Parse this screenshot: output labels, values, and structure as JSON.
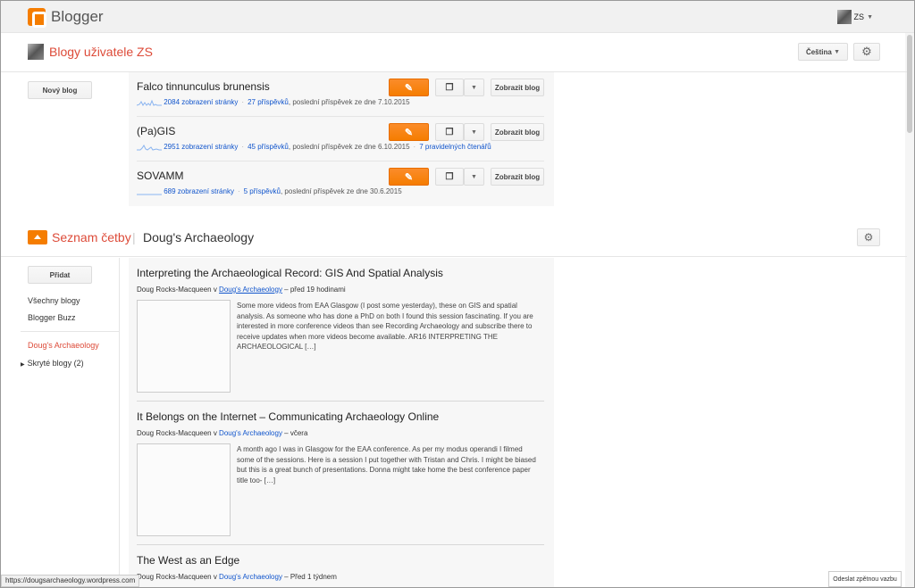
{
  "app": {
    "brand": "Blogger"
  },
  "user": {
    "initials": "ZS"
  },
  "blogs_section": {
    "title": "Blogy uživatele ZS",
    "language": "Čeština",
    "new_blog_label": "Nový blog",
    "view_label": "Zobrazit blog",
    "blogs": [
      {
        "name": "Falco tinnunculus brunensis",
        "views": "2084 zobrazení stránky",
        "posts": "27 příspěvků",
        "last": ", poslední příspěvek ze dne 7.10.2015",
        "readers": ""
      },
      {
        "name": "(Pa)GIS",
        "views": "2951 zobrazení stránky",
        "posts": "45 příspěvků",
        "last": ", poslední příspěvek ze dne 6.10.2015",
        "readers": "7 pravidelných čtenářů"
      },
      {
        "name": "SOVAMM",
        "views": "689 zobrazení stránky",
        "posts": "5 příspěvků",
        "last": ", poslední příspěvek ze dne 30.6.2015",
        "readers": ""
      }
    ]
  },
  "reading_section": {
    "title": "Seznam četby",
    "current": "Doug's Archaeology",
    "add_label": "Přidat",
    "sidebar": {
      "all": "Všechny blogy",
      "buzz": "Blogger Buzz",
      "active": "Doug's Archaeology",
      "hidden": "Skryté blogy (2)"
    },
    "posts": [
      {
        "title": "Interpreting the Archaeological Record: GIS And Spatial Analysis",
        "author": "Doug Rocks-Macqueen v ",
        "source": "Doug's Archaeology",
        "time": " – před 19 hodinami",
        "excerpt": "Some more videos from EAA Glasgow (I post some yesterday), these on GIS and spatial analysis. As someone who has done a PhD on both I found this session fascinating. If you are interested in more conference videos than see Recording Archaeology and subscribe there to receive updates when more videos become available. AR16 INTERPRETING THE ARCHAEOLOGICAL […]"
      },
      {
        "title": "It Belongs on the Internet – Communicating Archaeology Online",
        "author": "Doug Rocks-Macqueen v ",
        "source": "Doug's Archaeology",
        "time": " – včera",
        "excerpt": "A month ago I was in Glasgow for the EAA conference. As per my modus operandi I filmed some of the sessions. Here is a session I put together with Tristan and Chris. I might be biased but this is a great bunch of presentations. Donna might take home the best conference paper title too- […]"
      },
      {
        "title": "The West as an Edge",
        "author": "Doug Rocks-Macqueen v ",
        "source": "Doug's Archaeology",
        "time": " – Před 1 týdnem",
        "excerpt": ""
      }
    ]
  },
  "status_url": "https://dougsarchaeology.wordpress.com",
  "feedback_label": "Odeslat zpětnou vazbu",
  "colors": {
    "accent": "#f57d00",
    "title_red": "#dd4b39",
    "link": "#1155cc"
  }
}
